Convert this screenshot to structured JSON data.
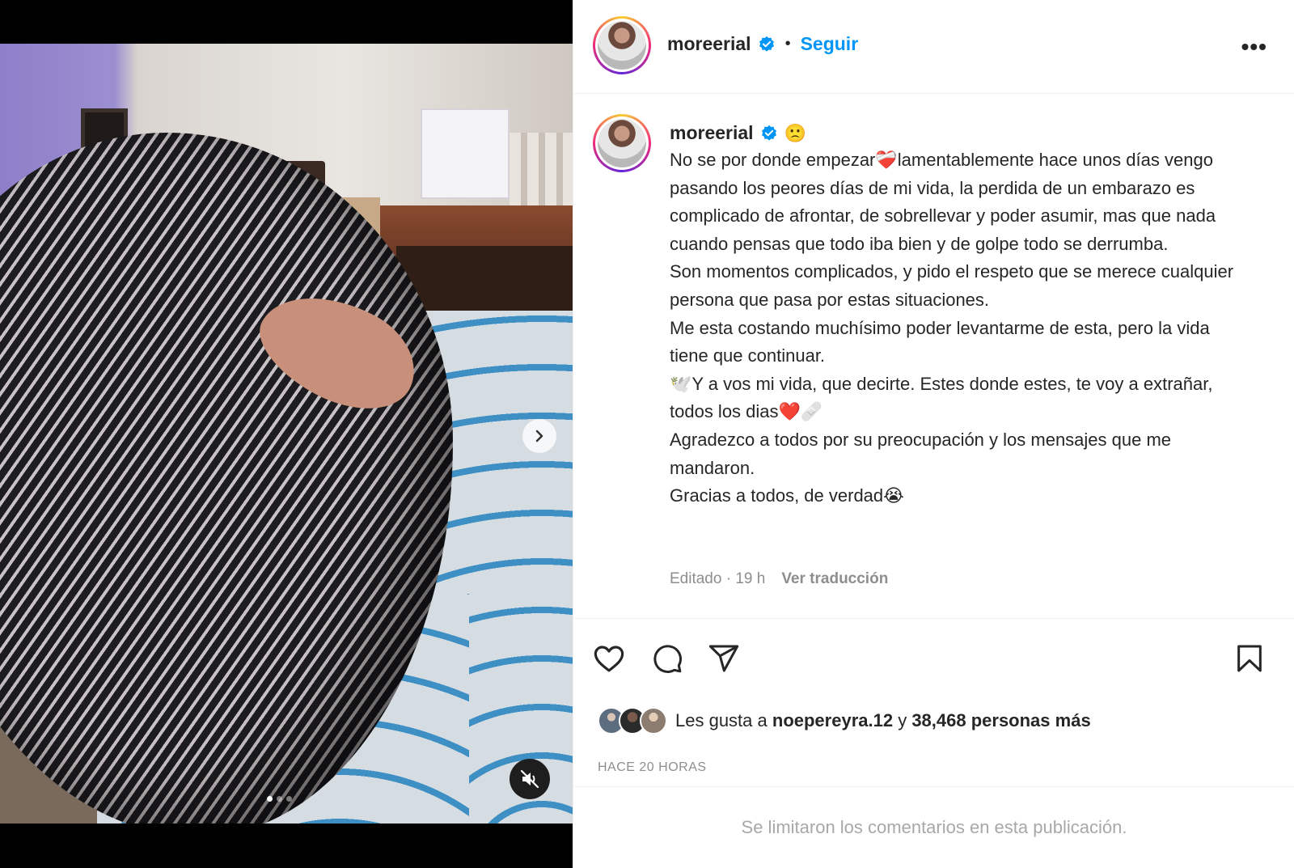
{
  "post": {
    "username": "moreerial",
    "follow_label": "Seguir",
    "separator": "•",
    "more_label": "•••"
  },
  "caption": {
    "username": "moreerial",
    "status_emoji": "🙁",
    "text": "No se por donde empezar❤️‍🩹lamentablemente hace unos días vengo pasando los peores días de mi vida, la perdida de un embarazo es complicado de afrontar, de sobrellevar y poder asumir, mas que nada cuando pensas que todo iba bien y de golpe todo se derrumba.\nSon momentos complicados, y pido el respeto que se merece cualquier persona que pasa por estas situaciones.\nMe esta costando muchísimo poder levantarme de esta, pero la vida tiene que continuar.\n🕊️Y a vos mi vida, que decirte. Estes donde estes, te voy a extrañar, todos los dias❤️🩹\nAgradezco a todos por su preocupación y los mensajes que me mandaron.\nGracias a todos, de verdad😭",
    "edited_time": "Editado · 19 h",
    "translate_label": "Ver traducción"
  },
  "likes": {
    "prefix": "Les gusta a ",
    "liker": "noepereyra.12",
    "middle": " y ",
    "count": "38,468 personas más"
  },
  "time_ago": "HACE 20 HORAS",
  "comments_notice": "Se limitaron los comentarios en esta publicación.",
  "carousel": {
    "slides": 3,
    "active": 1
  },
  "icons": {
    "verified": "verified-badge-icon",
    "like": "heart-icon",
    "comment": "comment-bubble-icon",
    "share": "paper-plane-icon",
    "save": "bookmark-icon",
    "next": "chevron-right-icon",
    "mute": "muted-speaker-icon"
  },
  "colors": {
    "accent": "#0095f6",
    "text": "#262626",
    "muted": "#8e8e8e"
  }
}
